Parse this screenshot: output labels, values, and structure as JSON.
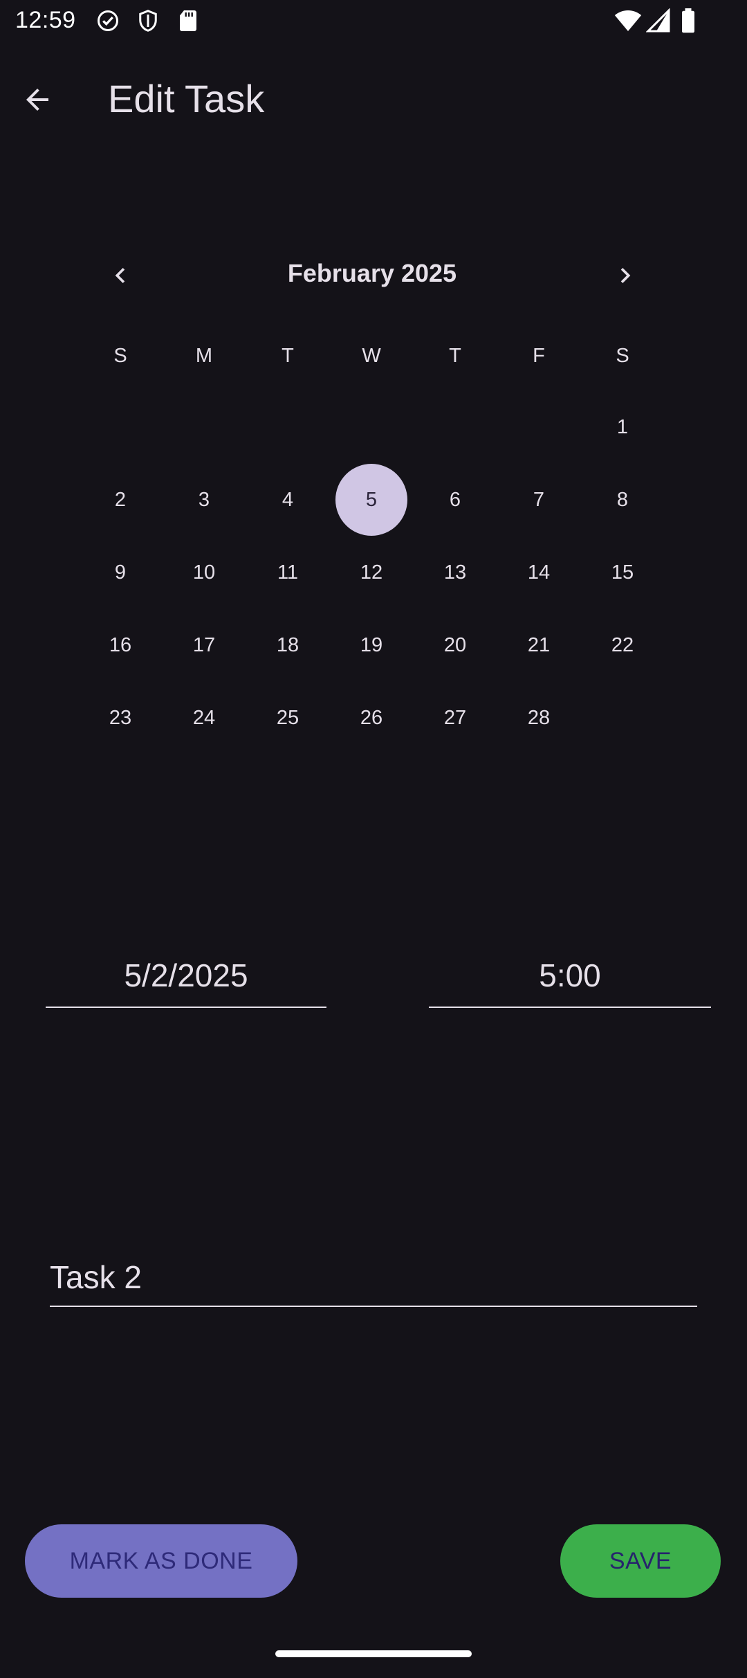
{
  "status_bar": {
    "time": "12:59",
    "icons": [
      "check-circle-icon",
      "shield-icon",
      "sd-card-icon",
      "wifi-icon",
      "signal-icon",
      "battery-icon"
    ]
  },
  "app_bar": {
    "title": "Edit Task",
    "back_icon": "arrow-back-icon"
  },
  "calendar": {
    "month_label": "February 2025",
    "weekdays": [
      "S",
      "M",
      "T",
      "W",
      "T",
      "F",
      "S"
    ],
    "days": [
      "1",
      "2",
      "3",
      "4",
      "5",
      "6",
      "7",
      "8",
      "9",
      "10",
      "11",
      "12",
      "13",
      "14",
      "15",
      "16",
      "17",
      "18",
      "19",
      "20",
      "21",
      "22",
      "23",
      "24",
      "25",
      "26",
      "27",
      "28"
    ],
    "first_weekday_index": 6,
    "selected_day": "5"
  },
  "form": {
    "date_value": "5/2/2025",
    "time_value": "5:00",
    "task_name_value": "Task 2"
  },
  "actions": {
    "mark_done_label": "MARK AS DONE",
    "save_label": "SAVE"
  },
  "colors": {
    "background": "#141218",
    "selected_day_bg": "#D0C6E4",
    "mark_done_bg": "#7471C4",
    "save_bg": "#3CAF4B"
  }
}
